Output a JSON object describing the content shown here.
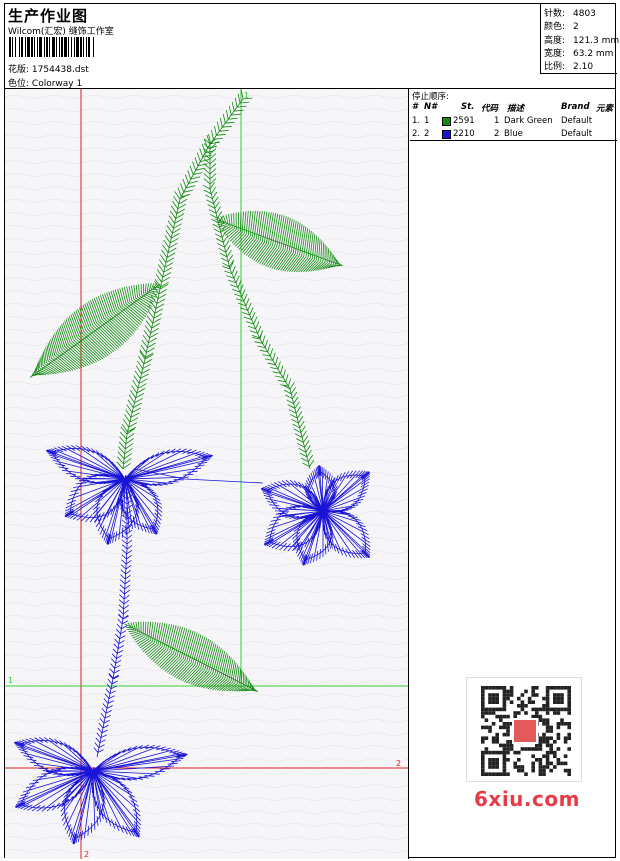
{
  "header": {
    "title": "生产作业图",
    "company": "Wilcom(汇宏) 缝饰工作室",
    "file_label": "花版:",
    "file_name": "1754438.dst",
    "colorway_label": "色位:",
    "colorway": "Colorway 1"
  },
  "stats": [
    {
      "label": "针数:",
      "value": "4803"
    },
    {
      "label": "颜色:",
      "value": "2"
    },
    {
      "label": "高度:",
      "value": "121.3 mm"
    },
    {
      "label": "宽度:",
      "value": "63.2 mm"
    },
    {
      "label": "比例:",
      "value": "2.10"
    }
  ],
  "stop_sequence": {
    "title": "停止顺序:",
    "columns": [
      "#",
      "N#",
      "St.",
      "代码",
      "描述",
      "Brand",
      "元素"
    ],
    "rows": [
      {
        "idx": "1.",
        "n": "1",
        "st": "2591",
        "code": "1",
        "desc": "Dark Green",
        "brand": "Default",
        "color": "#128a12"
      },
      {
        "idx": "2.",
        "n": "2",
        "st": "2210",
        "code": "2",
        "desc": "Blue",
        "brand": "Default",
        "color": "#1a14d8"
      }
    ]
  },
  "guides": {
    "marker_1": "1",
    "marker_2": "2"
  },
  "watermark": {
    "site": "6xiu.com"
  },
  "colors": {
    "green": "#128a12",
    "blue": "#1a14d8",
    "guide_red": "#e01e1e",
    "guide_green": "#2ed12e"
  }
}
